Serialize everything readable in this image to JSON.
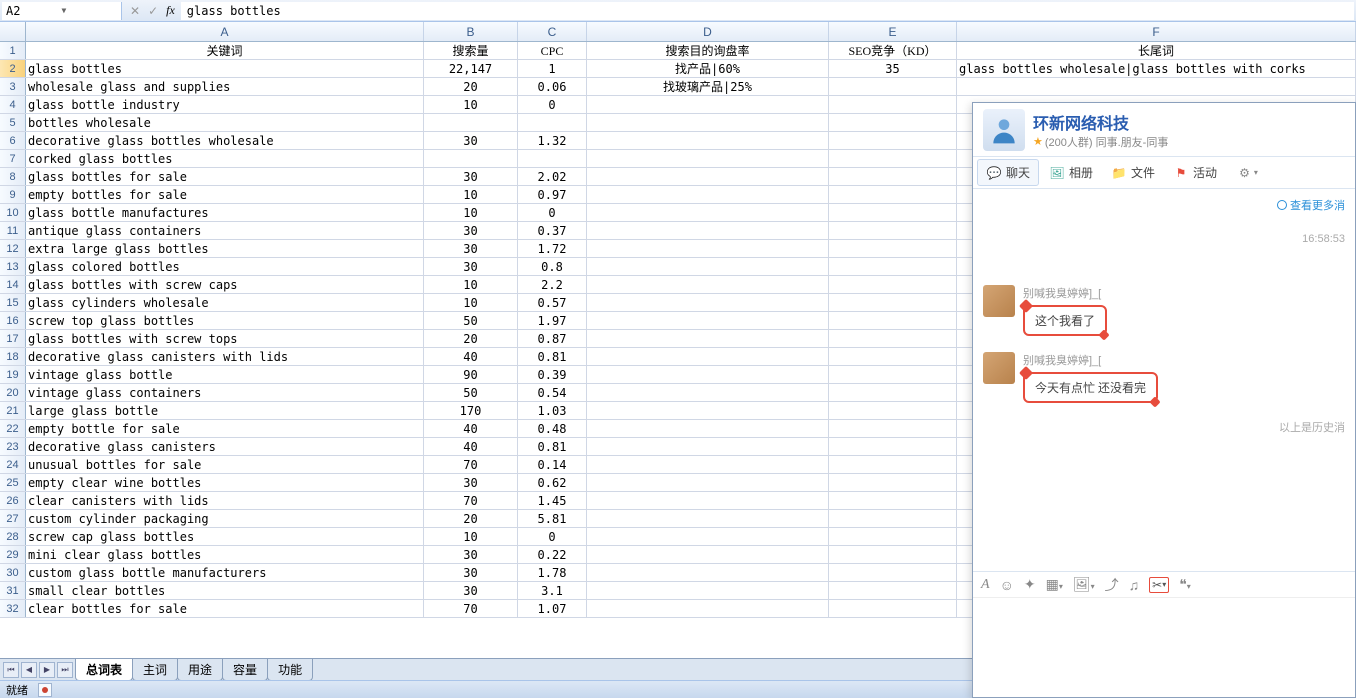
{
  "formula_bar": {
    "cell_ref": "A2",
    "fx_label": "fx",
    "formula_value": "glass bottles"
  },
  "columns": [
    "A",
    "B",
    "C",
    "D",
    "E",
    "F"
  ],
  "header_row": {
    "A": "关键词",
    "B": "搜索量",
    "C": "CPC",
    "D": "搜索目的询盘率",
    "E": "SEO竞争（KD）",
    "F": "长尾词"
  },
  "rows": [
    {
      "n": 2,
      "A": "glass bottles",
      "B": "22,147",
      "C": "1",
      "D": "找产品|60%",
      "E": "35",
      "F": "glass bottles wholesale|glass bottles with corks"
    },
    {
      "n": 3,
      "A": "wholesale glass and supplies",
      "B": "20",
      "C": "0.06",
      "D": "找玻璃产品|25%",
      "E": "",
      "F": ""
    },
    {
      "n": 4,
      "A": "glass bottle industry",
      "B": "10",
      "C": "0",
      "D": "",
      "E": "",
      "F": ""
    },
    {
      "n": 5,
      "A": "bottles wholesale",
      "B": "",
      "C": "",
      "D": "",
      "E": "",
      "F": ""
    },
    {
      "n": 6,
      "A": "decorative glass bottles wholesale",
      "B": "30",
      "C": "1.32",
      "D": "",
      "E": "",
      "F": ""
    },
    {
      "n": 7,
      "A": "corked glass bottles",
      "B": "",
      "C": "",
      "D": "",
      "E": "",
      "F": ""
    },
    {
      "n": 8,
      "A": "glass bottles for sale",
      "B": "30",
      "C": "2.02",
      "D": "",
      "E": "",
      "F": ""
    },
    {
      "n": 9,
      "A": "empty bottles for sale",
      "B": "10",
      "C": "0.97",
      "D": "",
      "E": "",
      "F": ""
    },
    {
      "n": 10,
      "A": "glass bottle manufactures",
      "B": "10",
      "C": "0",
      "D": "",
      "E": "",
      "F": ""
    },
    {
      "n": 11,
      "A": "antique glass containers",
      "B": "30",
      "C": "0.37",
      "D": "",
      "E": "",
      "F": ""
    },
    {
      "n": 12,
      "A": "extra large glass bottles",
      "B": "30",
      "C": "1.72",
      "D": "",
      "E": "",
      "F": ""
    },
    {
      "n": 13,
      "A": "glass colored bottles",
      "B": "30",
      "C": "0.8",
      "D": "",
      "E": "",
      "F": ""
    },
    {
      "n": 14,
      "A": "glass bottles with screw caps",
      "B": "10",
      "C": "2.2",
      "D": "",
      "E": "",
      "F": ""
    },
    {
      "n": 15,
      "A": "glass cylinders wholesale",
      "B": "10",
      "C": "0.57",
      "D": "",
      "E": "",
      "F": ""
    },
    {
      "n": 16,
      "A": "screw top glass bottles",
      "B": "50",
      "C": "1.97",
      "D": "",
      "E": "",
      "F": ""
    },
    {
      "n": 17,
      "A": "glass bottles with screw tops",
      "B": "20",
      "C": "0.87",
      "D": "",
      "E": "",
      "F": ""
    },
    {
      "n": 18,
      "A": "decorative glass canisters with lids",
      "B": "40",
      "C": "0.81",
      "D": "",
      "E": "",
      "F": ""
    },
    {
      "n": 19,
      "A": "vintage glass bottle",
      "B": "90",
      "C": "0.39",
      "D": "",
      "E": "",
      "F": ""
    },
    {
      "n": 20,
      "A": "vintage glass containers",
      "B": "50",
      "C": "0.54",
      "D": "",
      "E": "",
      "F": ""
    },
    {
      "n": 21,
      "A": "large glass bottle",
      "B": "170",
      "C": "1.03",
      "D": "",
      "E": "",
      "F": ""
    },
    {
      "n": 22,
      "A": "empty bottle for sale",
      "B": "40",
      "C": "0.48",
      "D": "",
      "E": "",
      "F": ""
    },
    {
      "n": 23,
      "A": "decorative glass canisters",
      "B": "40",
      "C": "0.81",
      "D": "",
      "E": "",
      "F": ""
    },
    {
      "n": 24,
      "A": "unusual bottles for sale",
      "B": "70",
      "C": "0.14",
      "D": "",
      "E": "",
      "F": ""
    },
    {
      "n": 25,
      "A": "empty clear wine bottles",
      "B": "30",
      "C": "0.62",
      "D": "",
      "E": "",
      "F": ""
    },
    {
      "n": 26,
      "A": "clear canisters with lids",
      "B": "70",
      "C": "1.45",
      "D": "",
      "E": "",
      "F": ""
    },
    {
      "n": 27,
      "A": "custom cylinder packaging",
      "B": "20",
      "C": "5.81",
      "D": "",
      "E": "",
      "F": ""
    },
    {
      "n": 28,
      "A": "screw cap glass bottles",
      "B": "10",
      "C": "0",
      "D": "",
      "E": "",
      "F": ""
    },
    {
      "n": 29,
      "A": "mini clear glass bottles",
      "B": "30",
      "C": "0.22",
      "D": "",
      "E": "",
      "F": ""
    },
    {
      "n": 30,
      "A": "custom glass bottle manufacturers",
      "B": "30",
      "C": "1.78",
      "D": "",
      "E": "",
      "F": ""
    },
    {
      "n": 31,
      "A": "small clear bottles",
      "B": "30",
      "C": "3.1",
      "D": "",
      "E": "",
      "F": ""
    },
    {
      "n": 32,
      "A": "clear bottles for sale",
      "B": "70",
      "C": "1.07",
      "D": "",
      "E": "",
      "F": ""
    }
  ],
  "sheet_tabs": [
    "总词表",
    "主词",
    "用途",
    "容量",
    "功能"
  ],
  "active_tab_index": 0,
  "status_bar": {
    "ready": "就绪"
  },
  "chat": {
    "title": "环新网络科技",
    "subtitle": "(200人群) 同事.朋友-同事",
    "tabs": [
      {
        "icon": "chat",
        "label": "聊天"
      },
      {
        "icon": "album",
        "label": "相册"
      },
      {
        "icon": "folder",
        "label": "文件"
      },
      {
        "icon": "flag",
        "label": "活动"
      }
    ],
    "more_messages": "查看更多消",
    "timestamp": "16:58:53",
    "messages": [
      {
        "sender": "别喊我臭婷婷]_[",
        "text": "这个我看了"
      },
      {
        "sender": "别喊我臭婷婷]_[",
        "text": "今天有点忙  还没看完"
      }
    ],
    "history_note": "以上是历史消"
  }
}
